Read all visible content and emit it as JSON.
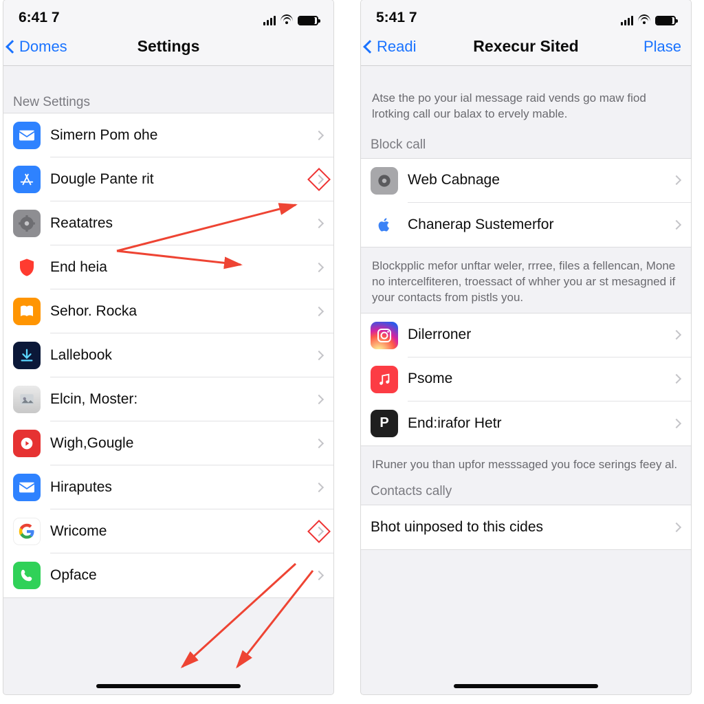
{
  "left": {
    "status": {
      "time": "6:41 7"
    },
    "nav": {
      "back": "Domes",
      "title": "Settings"
    },
    "section_header": "New Settings",
    "items": [
      {
        "label": "Simern Pom ohe",
        "icon": "mail-icon"
      },
      {
        "label": "Dougle Pante rit",
        "icon": "appstore-icon",
        "highlight": true
      },
      {
        "label": "Reatatres",
        "icon": "gear-icon"
      },
      {
        "label": "End heia",
        "icon": "shield-red-icon"
      },
      {
        "label": "Sehor. Rocka",
        "icon": "book-icon"
      },
      {
        "label": "Lallebook",
        "icon": "download-icon"
      },
      {
        "label": "Elcin, Moster:",
        "icon": "photo-icon"
      },
      {
        "label": "Wigh,Gougle",
        "icon": "play-icon"
      },
      {
        "label": "Hiraputes",
        "icon": "mail-icon"
      },
      {
        "label": "Wricome",
        "icon": "google-g-icon",
        "highlight": true
      },
      {
        "label": "Opface",
        "icon": "phone-icon"
      }
    ]
  },
  "right": {
    "status": {
      "time": "5:41 7"
    },
    "nav": {
      "back": "Readi",
      "title": "Rexecur Sited",
      "action": "Plase"
    },
    "intro_caption": "Atse the po your ial message raid vends go maw fiod lrotking call our balax to ervely mable.",
    "section1_header": "Block call",
    "section1_items": [
      {
        "label": "Web Cabnage",
        "icon": "settings-gear-icon"
      },
      {
        "label": "Chanerap Sustemerfor",
        "icon": "apple-icon"
      }
    ],
    "mid_caption": "Blockpplic mefor unftar weler, rrree, files a fellencan, Mone no intercelfiteren, troessact of whher you ar st mesagned if your contacts from pistls you.",
    "section2_items": [
      {
        "label": "Dilerroner",
        "icon": "instagram-icon"
      },
      {
        "label": "Psome",
        "icon": "music-icon"
      },
      {
        "label": "End:irafor Hetr",
        "icon": "p-letter-icon"
      }
    ],
    "post_caption": "IRuner you than upfor messsaged you foce serings feey al.",
    "section3_header": "Contacts cally",
    "section3_items": [
      {
        "label": "Bhot uinposed to this cides"
      }
    ]
  }
}
